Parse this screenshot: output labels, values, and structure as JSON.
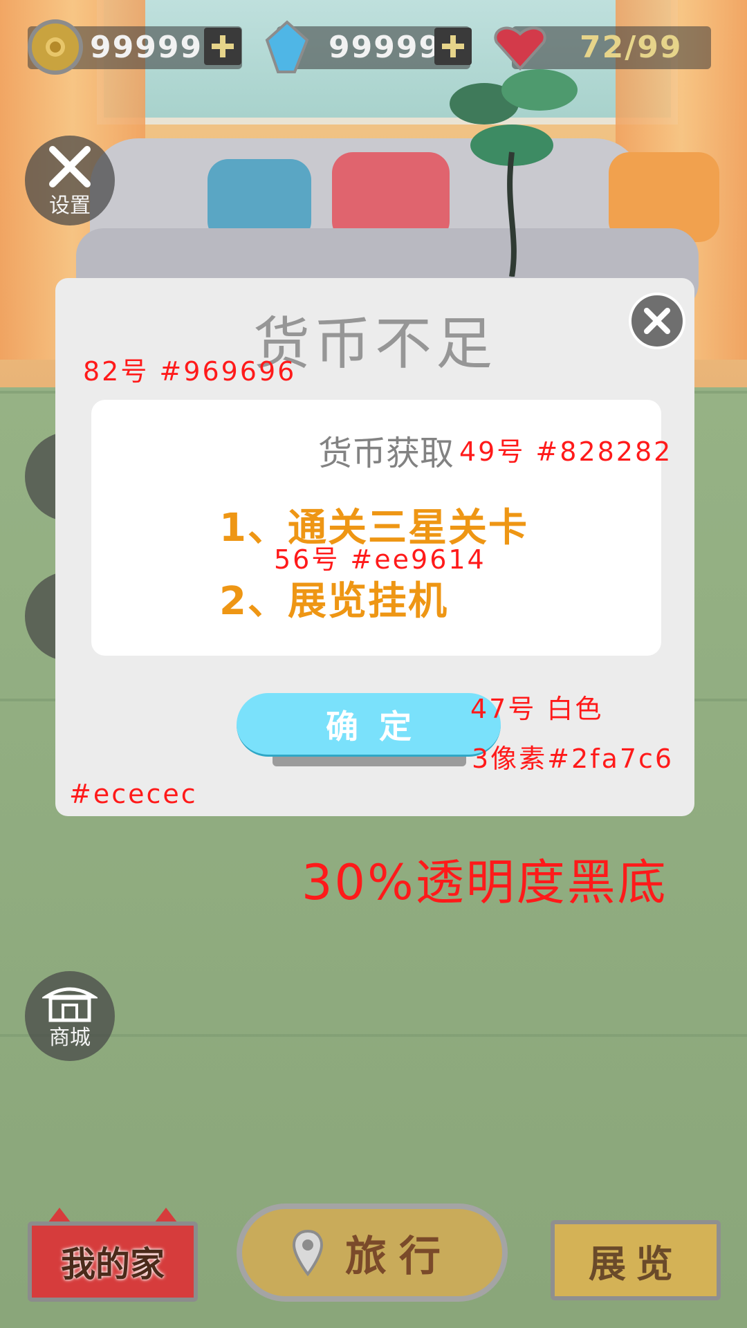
{
  "resources": {
    "coins": "999999",
    "gems": "99999",
    "hearts": "72/99"
  },
  "side_buttons": {
    "settings": "设置",
    "shop": "商城"
  },
  "dialog": {
    "title": "货币不足",
    "subtitle": "货币获取",
    "methods": [
      "1、通关三星关卡",
      "2、展览挂机"
    ],
    "confirm": "确定"
  },
  "annotations": {
    "title_spec": "82号 #969696",
    "subtitle_spec": "49号 #828282",
    "method_spec": "56号 #ee9614",
    "button_font_spec": "47号 白色",
    "button_border_spec": "3像素#2fa7c6",
    "dialog_bg_spec": "#ececec",
    "overlay_spec": "30%透明度黑底"
  },
  "bottom_nav": {
    "home": "我的家",
    "travel": "旅行",
    "exhibit": "展览"
  },
  "colors": {
    "title": "#969696",
    "subtitle": "#828282",
    "method": "#ee9614",
    "button_border": "#2fa7c6",
    "dialog_bg": "#ececec",
    "annotation": "#ff1a1a"
  }
}
